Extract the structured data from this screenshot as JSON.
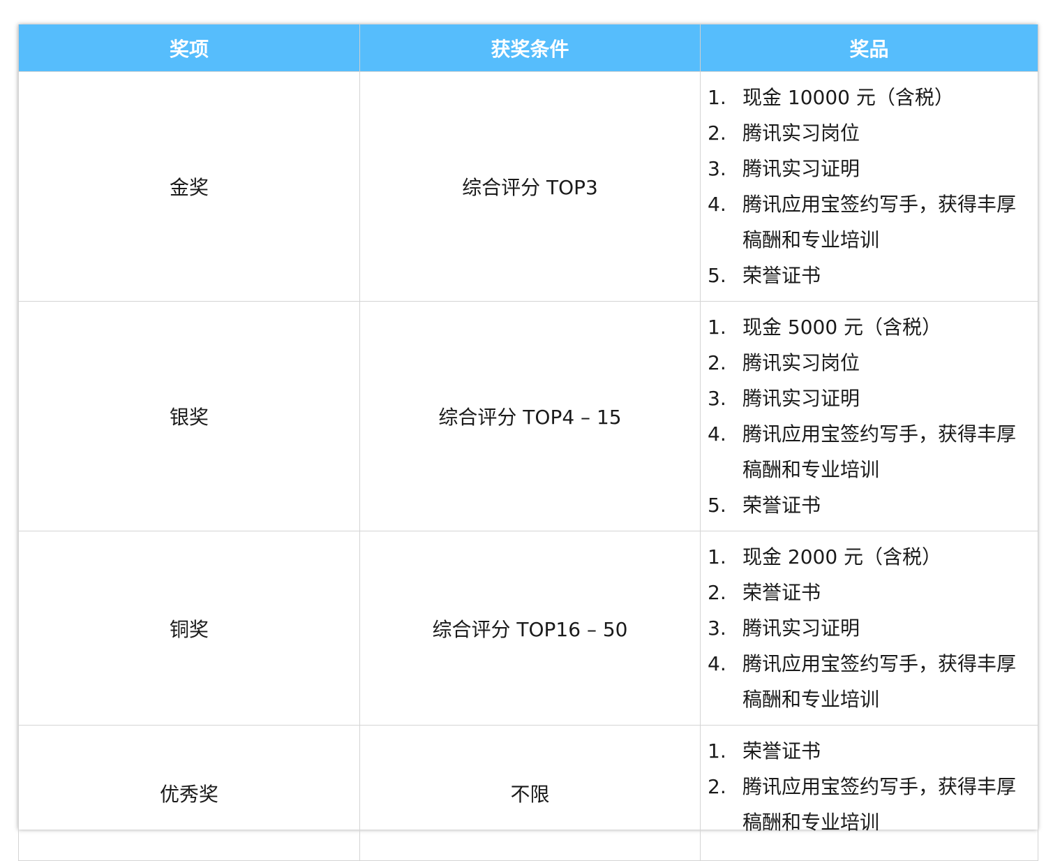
{
  "table": {
    "headers": [
      "奖项",
      "获奖条件",
      "奖品"
    ],
    "rows": [
      {
        "award": "金奖",
        "condition": "综合评分 TOP3",
        "prizes": [
          {
            "num": "1.",
            "text": "现金 10000 元（含税）"
          },
          {
            "num": "2.",
            "text": "腾讯实习岗位"
          },
          {
            "num": "3.",
            "text": "腾讯实习证明"
          },
          {
            "num": "4.",
            "text": "腾讯应用宝签约写手，获得丰厚稿酬和专业培训"
          },
          {
            "num": "5.",
            "text": "荣誉证书"
          }
        ]
      },
      {
        "award": "银奖",
        "condition": "综合评分 TOP4 – 15",
        "prizes": [
          {
            "num": "1.",
            "text": "现金 5000 元（含税）"
          },
          {
            "num": "2.",
            "text": "腾讯实习岗位"
          },
          {
            "num": "3.",
            "text": "腾讯实习证明"
          },
          {
            "num": "4.",
            "text": "腾讯应用宝签约写手，获得丰厚稿酬和专业培训"
          },
          {
            "num": "5.",
            "text": "荣誉证书"
          }
        ]
      },
      {
        "award": "铜奖",
        "condition": "综合评分 TOP16 – 50",
        "prizes": [
          {
            "num": "1.",
            "text": "现金 2000 元（含税）"
          },
          {
            "num": "2.",
            "text": "荣誉证书"
          },
          {
            "num": "3.",
            "text": "腾讯实习证明"
          },
          {
            "num": "4.",
            "text": "腾讯应用宝签约写手，获得丰厚稿酬和专业培训"
          }
        ]
      },
      {
        "award": "优秀奖",
        "condition": "不限",
        "prizes": [
          {
            "num": "1.",
            "text": "荣誉证书"
          },
          {
            "num": "2.",
            "text": "腾讯应用宝签约写手，获得丰厚稿酬和专业培训"
          }
        ]
      }
    ]
  },
  "colors": {
    "header_bg": "#56bdfc",
    "header_text": "#ffffff",
    "grid_line": "#d4d4d4",
    "body_text": "#1a1a1a"
  }
}
